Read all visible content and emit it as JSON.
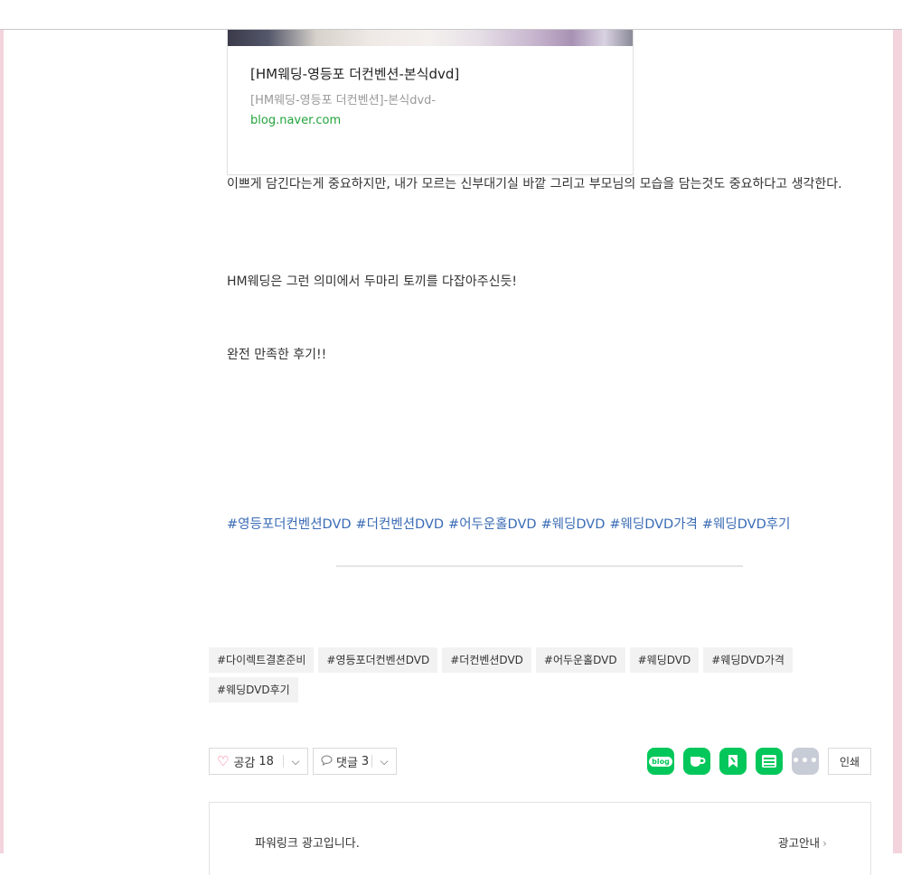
{
  "link_card": {
    "title": "[HM웨딩-영등포 더컨벤션-본식dvd]",
    "description": "[HM웨딩-영등포 더컨벤션]-본식dvd-",
    "domain": "blog.naver.com"
  },
  "paragraphs": [
    "이쁘게 담긴다는게 중요하지만, 내가 모르는 신부대기실 바깥 그리고 부모님의 모습을 담는것도 중요하다고 생각한다.",
    "HM웨딩은 그런 의미에서 두마리 토끼를 다잡아주신듯!",
    "완전 만족한 후기!!"
  ],
  "inline_hashtags": [
    "#영등포더컨벤션DVD",
    "#더컨벤션DVD",
    "#어두운홀DVD",
    "#웨딩DVD",
    "#웨딩DVD가격",
    "#웨딩DVD후기"
  ],
  "tag_chips": [
    "#다이렉트결혼준비",
    "#영등포더컨벤션DVD",
    "#더컨벤션DVD",
    "#어두운홀DVD",
    "#웨딩DVD",
    "#웨딩DVD가격",
    "#웨딩DVD후기"
  ],
  "actions": {
    "like_label": "공감",
    "like_count": "18",
    "comment_label": "댓글",
    "comment_count": "3",
    "share_icons": [
      "blog-icon",
      "cafe-icon",
      "keep-icon",
      "memo-icon",
      "more-icon"
    ],
    "blog_icon_text": "blog",
    "print_label": "인쇄"
  },
  "ad": {
    "label": "파워링크 광고입니다.",
    "info": "광고안내"
  },
  "colors": {
    "naver_green": "#03c75a",
    "hashtag_blue": "#3a6bb5",
    "side_pink": "#f3d3dc",
    "heart_pink": "#f35a7f"
  }
}
